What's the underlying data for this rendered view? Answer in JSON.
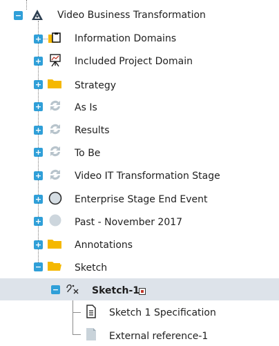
{
  "tree": {
    "root": {
      "label": "Video Business Transformation",
      "toggle": "−",
      "icon": "triangle-people-icon"
    },
    "items": [
      {
        "label": "Information Domains",
        "toggle": "+",
        "icon": "folder-clipboard-icon"
      },
      {
        "label": "Included Project Domain",
        "toggle": "+",
        "icon": "presentation-board-icon"
      },
      {
        "label": "Strategy",
        "toggle": "+",
        "icon": "folder-icon"
      },
      {
        "label": "As Is",
        "toggle": "+",
        "icon": "cycle-arrows-icon"
      },
      {
        "label": "Results",
        "toggle": "+",
        "icon": "cycle-arrows-icon"
      },
      {
        "label": "To Be",
        "toggle": "+",
        "icon": "cycle-arrows-icon"
      },
      {
        "label": "Video IT Transformation Stage",
        "toggle": "+",
        "icon": "cycle-arrows-icon"
      },
      {
        "label": "Enterprise Stage End Event",
        "toggle": "+",
        "icon": "circle-outline-icon"
      },
      {
        "label": "Past - November 2017",
        "toggle": "+",
        "icon": "circle-filled-icon"
      },
      {
        "label": "Annotations",
        "toggle": "+",
        "icon": "folder-icon"
      },
      {
        "label": "Sketch",
        "toggle": "−",
        "icon": "folder-open-icon"
      }
    ],
    "sketch_child": {
      "label": "Sketch-1",
      "toggle": "−",
      "icon": "sketch-icon",
      "badge_icon": "diagram-badge-icon"
    },
    "leaves": [
      {
        "label": "Sketch 1 Specification",
        "icon": "document-icon"
      },
      {
        "label": "External reference-1",
        "icon": "document-folded-icon"
      }
    ]
  },
  "colors": {
    "toggle": "#2f9fd8",
    "folder": "#f5b800",
    "selected_row": "#dde3ea",
    "cycle_icon": "#b8c4cc"
  }
}
